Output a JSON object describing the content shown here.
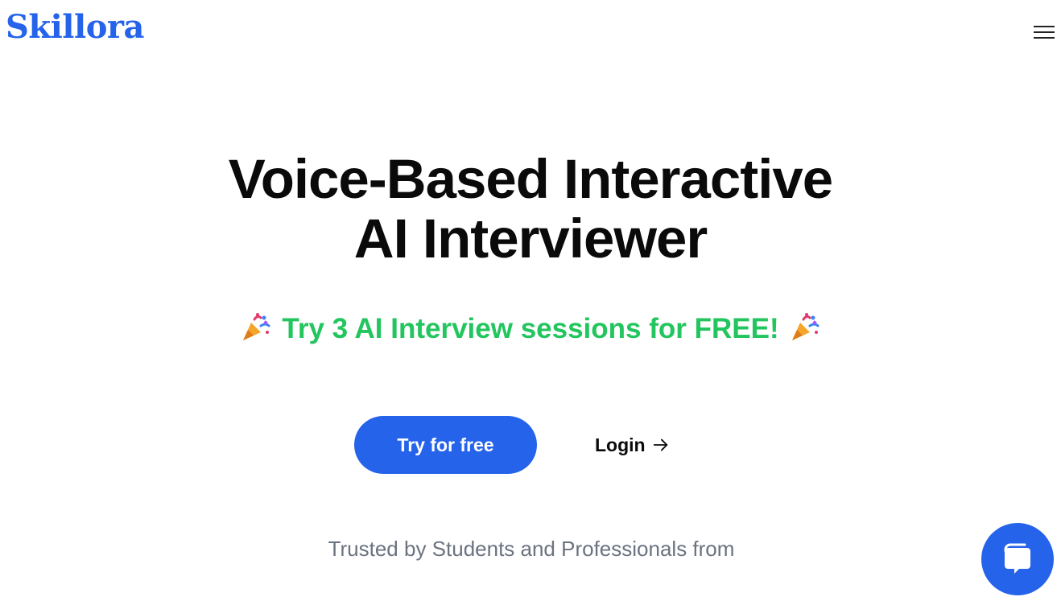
{
  "brand": {
    "name": "Skillora",
    "color": "#2563eb"
  },
  "header": {
    "menu_icon": "hamburger-menu-icon"
  },
  "hero": {
    "title_line1": "Voice-Based Interactive",
    "title_line2": "AI Interviewer",
    "promo_text": "Try 3 AI Interview sessions for FREE!",
    "promo_icon": "party-popper-icon",
    "promo_color": "#22c55e"
  },
  "cta": {
    "try_label": "Try for free",
    "login_label": "Login",
    "login_icon": "arrow-right-icon"
  },
  "trusted": {
    "text": "Trusted by Students and Professionals from"
  },
  "chat": {
    "icon": "chat-bubble-icon"
  }
}
